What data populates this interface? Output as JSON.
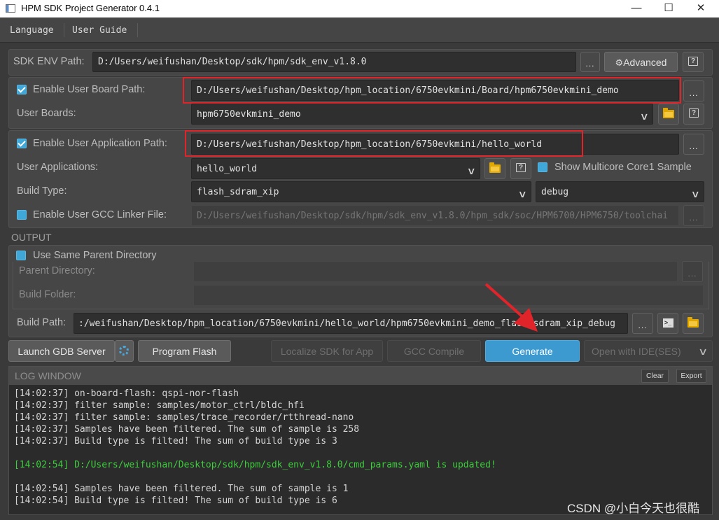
{
  "window": {
    "title": "HPM SDK Project Generator 0.4.1"
  },
  "menu": {
    "items": [
      "Language",
      "User Guide"
    ]
  },
  "sdk": {
    "label": "SDK ENV Path:",
    "value": "D:/Users/weifushan/Desktop/sdk/hpm/sdk_env_v1.8.0",
    "browse": "...",
    "advanced": "Advanced"
  },
  "board": {
    "enable_label": "Enable User Board Path:",
    "path": "D:/Users/weifushan/Desktop/hpm_location/6750evkmini/Board/hpm6750evkmini_demo",
    "boards_label": "User Boards:",
    "boards_value": "hpm6750evkmini_demo",
    "browse": "..."
  },
  "app": {
    "enable_label": "Enable User Application Path:",
    "path": "D:/Users/weifushan/Desktop/hpm_location/6750evkmini/hello_world",
    "apps_label": "User Applications:",
    "apps_value": "hello_world",
    "multicore_label": "Show Multicore Core1 Sample",
    "browse": "..."
  },
  "build": {
    "label": "Build Type:",
    "type_value": "flash_sdram_xip",
    "mode_value": "debug"
  },
  "linker": {
    "label": "Enable User GCC Linker File:",
    "value": "D:/Users/weifushan/Desktop/sdk/hpm/sdk_env_v1.8.0/hpm_sdk/soc/HPM6700/HPM6750/toolchai",
    "browse": "..."
  },
  "output": {
    "title": "OUTPUT",
    "same_parent_label": "Use Same Parent Directory",
    "parent_label": "Parent Directory:",
    "folder_label": "Build Folder:",
    "build_path_label": "Build Path:",
    "build_path_value": ":/weifushan/Desktop/hpm_location/6750evkmini/hello_world/hpm6750evkmini_demo_flash_sdram_xip_debug",
    "browse": "..."
  },
  "actions": {
    "gdb": "Launch GDB Server",
    "flash": "Program Flash",
    "localize": "Localize SDK for App",
    "compile": "GCC Compile",
    "generate": "Generate",
    "open_ide": "Open with IDE(SES)"
  },
  "log": {
    "title": "LOG WINDOW",
    "clear": "Clear",
    "export": "Export",
    "lines": [
      "[14:02:37] on-board-flash: qspi-nor-flash",
      "[14:02:37] filter sample: samples/motor_ctrl/bldc_hfi",
      "[14:02:37] filter sample: samples/trace_recorder/rtthread-nano",
      "[14:02:37] Samples have been filtered. The sum of sample is 258",
      "[14:02:37] Build type is filted! The sum of build type is 3",
      "[14:02:54] D:/Users/weifushan/Desktop/sdk/hpm/sdk_env_v1.8.0/cmd_params.yaml is updated!",
      "[14:02:54] Samples have been filtered. The sum of sample is 1",
      "[14:02:54] Build type is filted! The sum of build type is 6"
    ]
  },
  "watermark": "CSDN @小白今天也很酷",
  "colors": {
    "accent": "#3c9ad0",
    "highlight": "#e0242a",
    "log_green": "#3dcd3d"
  }
}
